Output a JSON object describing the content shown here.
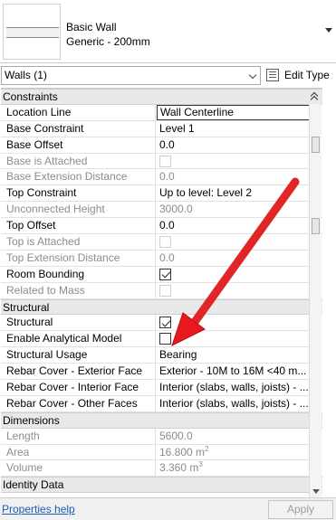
{
  "type_selector": {
    "family": "Basic Wall",
    "type": "Generic - 200mm"
  },
  "instance_filter": {
    "selected": "Walls (1)"
  },
  "edit_type_label": "Edit Type",
  "groups": [
    {
      "title": "Constraints",
      "rows": [
        {
          "name": "Location Line",
          "value": "Wall Centerline",
          "kind": "text",
          "enabled": true,
          "active": true
        },
        {
          "name": "Base Constraint",
          "value": "Level 1",
          "kind": "text",
          "enabled": true
        },
        {
          "name": "Base Offset",
          "value": "0.0",
          "kind": "text",
          "enabled": true
        },
        {
          "name": "Base is Attached",
          "value": "",
          "kind": "checkbox",
          "checked": false,
          "enabled": false
        },
        {
          "name": "Base Extension Distance",
          "value": "0.0",
          "kind": "text",
          "enabled": false
        },
        {
          "name": "Top Constraint",
          "value": "Up to level: Level 2",
          "kind": "text",
          "enabled": true
        },
        {
          "name": "Unconnected Height",
          "value": "3000.0",
          "kind": "text",
          "enabled": false
        },
        {
          "name": "Top Offset",
          "value": "0.0",
          "kind": "text",
          "enabled": true
        },
        {
          "name": "Top is Attached",
          "value": "",
          "kind": "checkbox",
          "checked": false,
          "enabled": false
        },
        {
          "name": "Top Extension Distance",
          "value": "0.0",
          "kind": "text",
          "enabled": false
        },
        {
          "name": "Room Bounding",
          "value": "",
          "kind": "checkbox",
          "checked": true,
          "enabled": true
        },
        {
          "name": "Related to Mass",
          "value": "",
          "kind": "checkbox",
          "checked": false,
          "enabled": false
        }
      ]
    },
    {
      "title": "Structural",
      "rows": [
        {
          "name": "Structural",
          "value": "",
          "kind": "checkbox",
          "checked": true,
          "enabled": true
        },
        {
          "name": "Enable Analytical Model",
          "value": "",
          "kind": "checkbox",
          "checked": false,
          "enabled": true
        },
        {
          "name": "Structural Usage",
          "value": "Bearing",
          "kind": "text",
          "enabled": true
        },
        {
          "name": "Rebar Cover - Exterior Face",
          "value": "Exterior - 10M to 16M <40 m...",
          "kind": "text",
          "enabled": true
        },
        {
          "name": "Rebar Cover - Interior Face",
          "value": "Interior (slabs, walls, joists) - ...",
          "kind": "text",
          "enabled": true
        },
        {
          "name": "Rebar Cover - Other Faces",
          "value": "Interior (slabs, walls, joists) - ...",
          "kind": "text",
          "enabled": true
        }
      ]
    },
    {
      "title": "Dimensions",
      "rows": [
        {
          "name": "Length",
          "value": "5600.0",
          "kind": "text",
          "enabled": false
        },
        {
          "name": "Area",
          "value": "16.800 m",
          "unit_sup": "2",
          "kind": "text",
          "enabled": false
        },
        {
          "name": "Volume",
          "value": "3.360 m",
          "unit_sup": "3",
          "kind": "text",
          "enabled": false
        }
      ]
    },
    {
      "title": "Identity Data",
      "rows": []
    }
  ],
  "footer": {
    "help_link": "Properties help",
    "apply_label": "Apply"
  },
  "annotation_color": "#e8191e"
}
